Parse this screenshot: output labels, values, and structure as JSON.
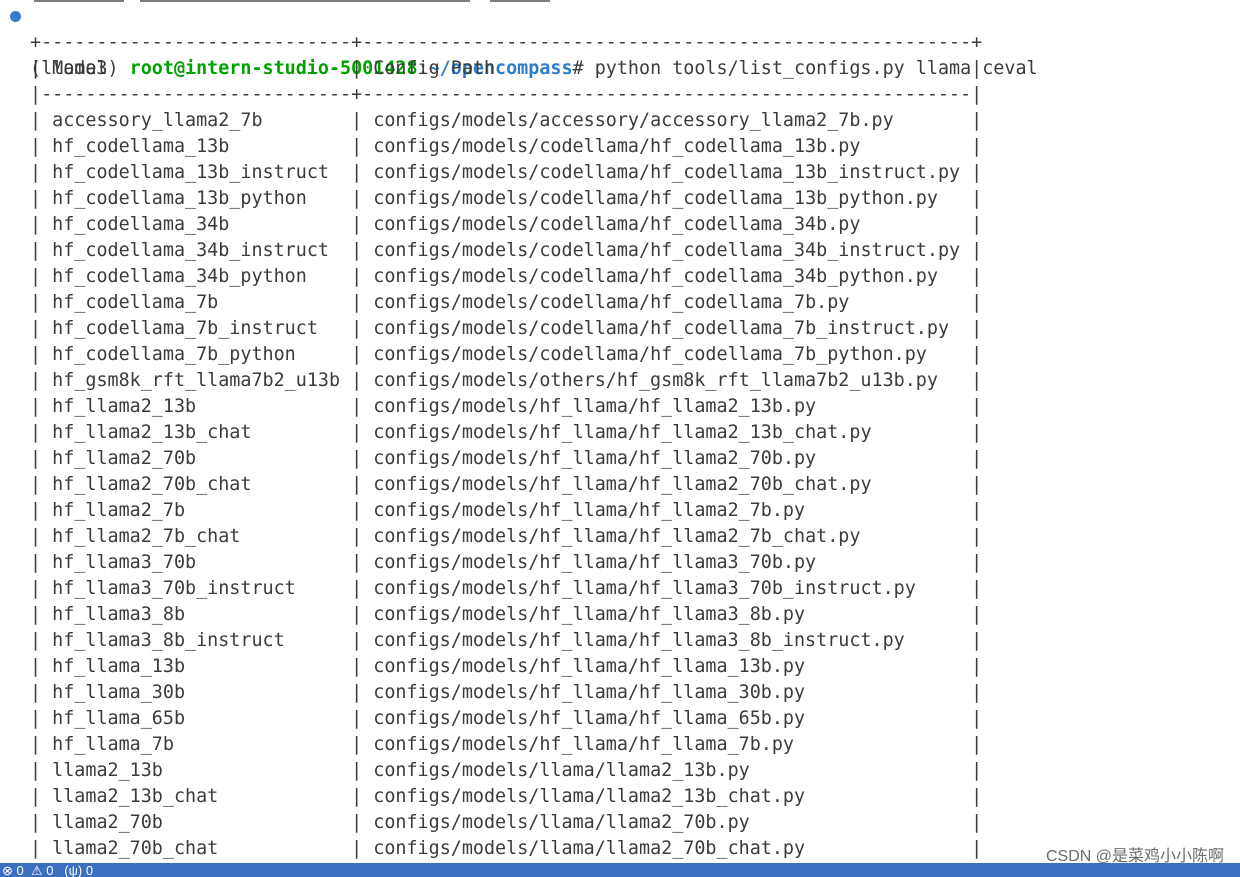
{
  "prompt": {
    "env": "(llama3) ",
    "user": "root@intern-studio-5001428",
    "sep": ":",
    "path": "~/opencompass",
    "sigil": "# ",
    "command": "python tools/list_configs.py llama ceval",
    "dot_color": "#3a7bc8"
  },
  "table": {
    "border_top": "+----------------------------+-------------------------------------------------------+",
    "separator": "|----------------------------+-------------------------------------------------------|",
    "headers": [
      "Model",
      "Config Path"
    ],
    "rows": [
      [
        "accessory_llama2_7b",
        "configs/models/accessory/accessory_llama2_7b.py"
      ],
      [
        "hf_codellama_13b",
        "configs/models/codellama/hf_codellama_13b.py"
      ],
      [
        "hf_codellama_13b_instruct",
        "configs/models/codellama/hf_codellama_13b_instruct.py"
      ],
      [
        "hf_codellama_13b_python",
        "configs/models/codellama/hf_codellama_13b_python.py"
      ],
      [
        "hf_codellama_34b",
        "configs/models/codellama/hf_codellama_34b.py"
      ],
      [
        "hf_codellama_34b_instruct",
        "configs/models/codellama/hf_codellama_34b_instruct.py"
      ],
      [
        "hf_codellama_34b_python",
        "configs/models/codellama/hf_codellama_34b_python.py"
      ],
      [
        "hf_codellama_7b",
        "configs/models/codellama/hf_codellama_7b.py"
      ],
      [
        "hf_codellama_7b_instruct",
        "configs/models/codellama/hf_codellama_7b_instruct.py"
      ],
      [
        "hf_codellama_7b_python",
        "configs/models/codellama/hf_codellama_7b_python.py"
      ],
      [
        "hf_gsm8k_rft_llama7b2_u13b",
        "configs/models/others/hf_gsm8k_rft_llama7b2_u13b.py"
      ],
      [
        "hf_llama2_13b",
        "configs/models/hf_llama/hf_llama2_13b.py"
      ],
      [
        "hf_llama2_13b_chat",
        "configs/models/hf_llama/hf_llama2_13b_chat.py"
      ],
      [
        "hf_llama2_70b",
        "configs/models/hf_llama/hf_llama2_70b.py"
      ],
      [
        "hf_llama2_70b_chat",
        "configs/models/hf_llama/hf_llama2_70b_chat.py"
      ],
      [
        "hf_llama2_7b",
        "configs/models/hf_llama/hf_llama2_7b.py"
      ],
      [
        "hf_llama2_7b_chat",
        "configs/models/hf_llama/hf_llama2_7b_chat.py"
      ],
      [
        "hf_llama3_70b",
        "configs/models/hf_llama/hf_llama3_70b.py"
      ],
      [
        "hf_llama3_70b_instruct",
        "configs/models/hf_llama/hf_llama3_70b_instruct.py"
      ],
      [
        "hf_llama3_8b",
        "configs/models/hf_llama/hf_llama3_8b.py"
      ],
      [
        "hf_llama3_8b_instruct",
        "configs/models/hf_llama/hf_llama3_8b_instruct.py"
      ],
      [
        "hf_llama_13b",
        "configs/models/hf_llama/hf_llama_13b.py"
      ],
      [
        "hf_llama_30b",
        "configs/models/hf_llama/hf_llama_30b.py"
      ],
      [
        "hf_llama_65b",
        "configs/models/hf_llama/hf_llama_65b.py"
      ],
      [
        "hf_llama_7b",
        "configs/models/hf_llama/hf_llama_7b.py"
      ],
      [
        "llama2_13b",
        "configs/models/llama/llama2_13b.py"
      ],
      [
        "llama2_13b_chat",
        "configs/models/llama/llama2_13b_chat.py"
      ],
      [
        "llama2_70b",
        "configs/models/llama/llama2_70b.py"
      ],
      [
        "llama2_70b_chat",
        "configs/models/llama/llama2_70b_chat.py"
      ]
    ]
  },
  "watermark": "CSDN @是菜鸡小小陈啊",
  "statusbar": {
    "text": "⊗ 0  ⚠ 0   (ψ) 0",
    "color": "#3a6fbf"
  }
}
